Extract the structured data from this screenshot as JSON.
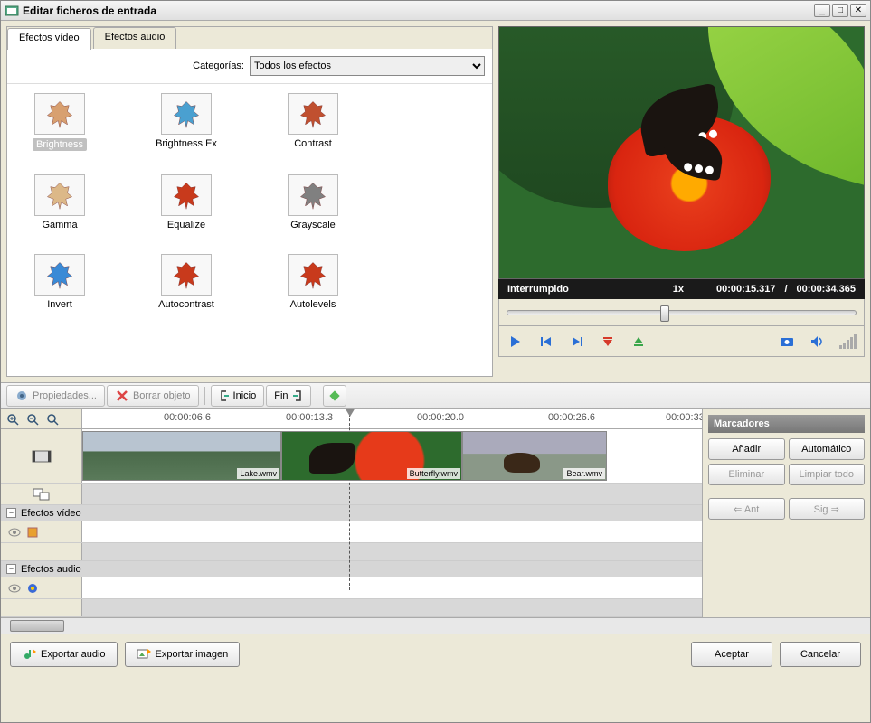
{
  "window": {
    "title": "Editar ficheros de entrada"
  },
  "tabs": {
    "video": "Efectos vídeo",
    "audio": "Efectos audio"
  },
  "categories": {
    "label": "Categorías:",
    "selected": "Todos los efectos"
  },
  "effects": [
    {
      "name": "Brightness",
      "selected": true,
      "tint": "#d8a070"
    },
    {
      "name": "Brightness Ex",
      "tint": "#4aa0d0"
    },
    {
      "name": "Contrast",
      "tint": "#c05030"
    },
    {
      "name": "Gamma",
      "tint": "#dcb888"
    },
    {
      "name": "Equalize",
      "tint": "#c83a1c"
    },
    {
      "name": "Grayscale",
      "tint": "#808080"
    },
    {
      "name": "Invert",
      "tint": "#3a8ad6"
    },
    {
      "name": "Autocontrast",
      "tint": "#c83a1c"
    },
    {
      "name": "Autolevels",
      "tint": "#c83a1c"
    }
  ],
  "preview": {
    "status": "Interrumpido",
    "speed": "1x",
    "current": "00:00:15.317",
    "total": "00:00:34.365",
    "sep": "/"
  },
  "toolbar": {
    "properties": "Propiedades...",
    "delete": "Borrar objeto",
    "start": "Inicio",
    "end": "Fin"
  },
  "timeline": {
    "ticks": [
      "00:00:06.6",
      "00:00:13.3",
      "00:00:20.0",
      "00:00:26.6",
      "00:00:33"
    ],
    "clips": [
      {
        "label": "Lake.wmv"
      },
      {
        "label": "Butterfly.wmv"
      },
      {
        "label": "Bear.wmv"
      }
    ],
    "sections": {
      "video": "Efectos vídeo",
      "audio": "Efectos audio"
    }
  },
  "markers": {
    "title": "Marcadores",
    "add": "Añadir",
    "auto": "Automático",
    "remove": "Eliminar",
    "clear": "Limpiar todo",
    "prev": "Ant",
    "next": "Sig"
  },
  "footer": {
    "export_audio": "Exportar audio",
    "export_image": "Exportar imagen",
    "accept": "Aceptar",
    "cancel": "Cancelar"
  }
}
